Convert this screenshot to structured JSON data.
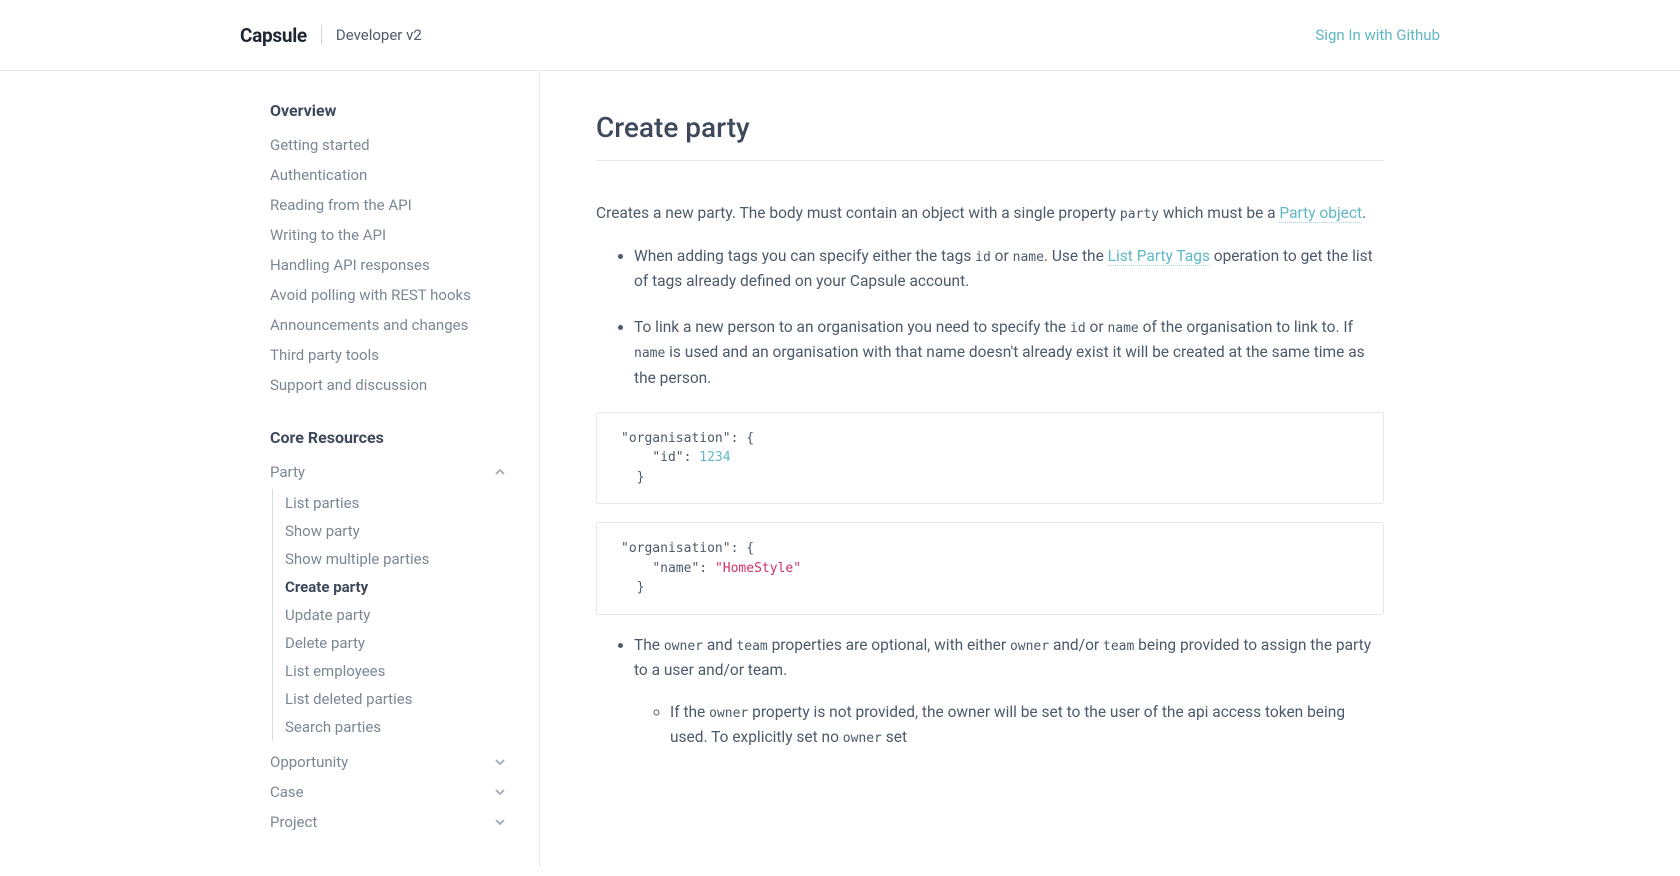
{
  "header": {
    "logo": "Capsule",
    "subtitle": "Developer v2",
    "signin": "Sign In with Github"
  },
  "sidebar": {
    "sections": [
      {
        "title": "Overview",
        "items": [
          {
            "label": "Getting started"
          },
          {
            "label": "Authentication"
          },
          {
            "label": "Reading from the API"
          },
          {
            "label": "Writing to the API"
          },
          {
            "label": "Handling API responses"
          },
          {
            "label": "Avoid polling with REST hooks"
          },
          {
            "label": "Announcements and changes"
          },
          {
            "label": "Third party tools"
          },
          {
            "label": "Support and discussion"
          }
        ]
      },
      {
        "title": "Core Resources",
        "items": [
          {
            "label": "Party",
            "expanded": true,
            "children": [
              {
                "label": "List parties"
              },
              {
                "label": "Show party"
              },
              {
                "label": "Show multiple parties"
              },
              {
                "label": "Create party",
                "active": true
              },
              {
                "label": "Update party"
              },
              {
                "label": "Delete party"
              },
              {
                "label": "List employees"
              },
              {
                "label": "List deleted parties"
              },
              {
                "label": "Search parties"
              }
            ]
          },
          {
            "label": "Opportunity",
            "collapsible": true
          },
          {
            "label": "Case",
            "collapsible": true
          },
          {
            "label": "Project",
            "collapsible": true
          }
        ]
      }
    ]
  },
  "page": {
    "title": "Create party",
    "intro_a": "Creates a new party. The body must contain an object with a single property ",
    "intro_code": "party",
    "intro_b": " which must be a ",
    "intro_link": "Party object",
    "intro_c": ".",
    "bullets_1": {
      "a": "When adding tags you can specify either the tags ",
      "code1": "id",
      "b": " or ",
      "code2": "name",
      "c": ". Use the ",
      "link": "List Party Tags",
      "d": " operation to get the list of tags already defined on your Capsule account."
    },
    "bullets_2": {
      "a": "To link a new person to an organisation you need to specify the ",
      "code1": "id",
      "b": " or ",
      "code2": "name",
      "c": " of the organisation to link to. If ",
      "code3": "name",
      "d": " is used and an organisation with that name doesn't already exist it will be created at the same time as the person."
    },
    "code1": {
      "k1": "\"organisation\"",
      "k2": "\"id\"",
      "v": "1234"
    },
    "code2": {
      "k1": "\"organisation\"",
      "k2": "\"name\"",
      "v": "\"HomeStyle\""
    },
    "bullets_3": {
      "a": "The ",
      "code1": "owner",
      "b": " and ",
      "code2": "team",
      "c": " properties are optional, with either ",
      "code3": "owner",
      "d": " and/or ",
      "code4": "team",
      "e": " being provided to assign the party to a user and/or team."
    },
    "nested_1": {
      "a": "If the ",
      "code1": "owner",
      "b": " property is not provided, the owner will be set to the user of the api access token being used. To explicitly set no ",
      "code2": "owner",
      "c": " set"
    }
  }
}
